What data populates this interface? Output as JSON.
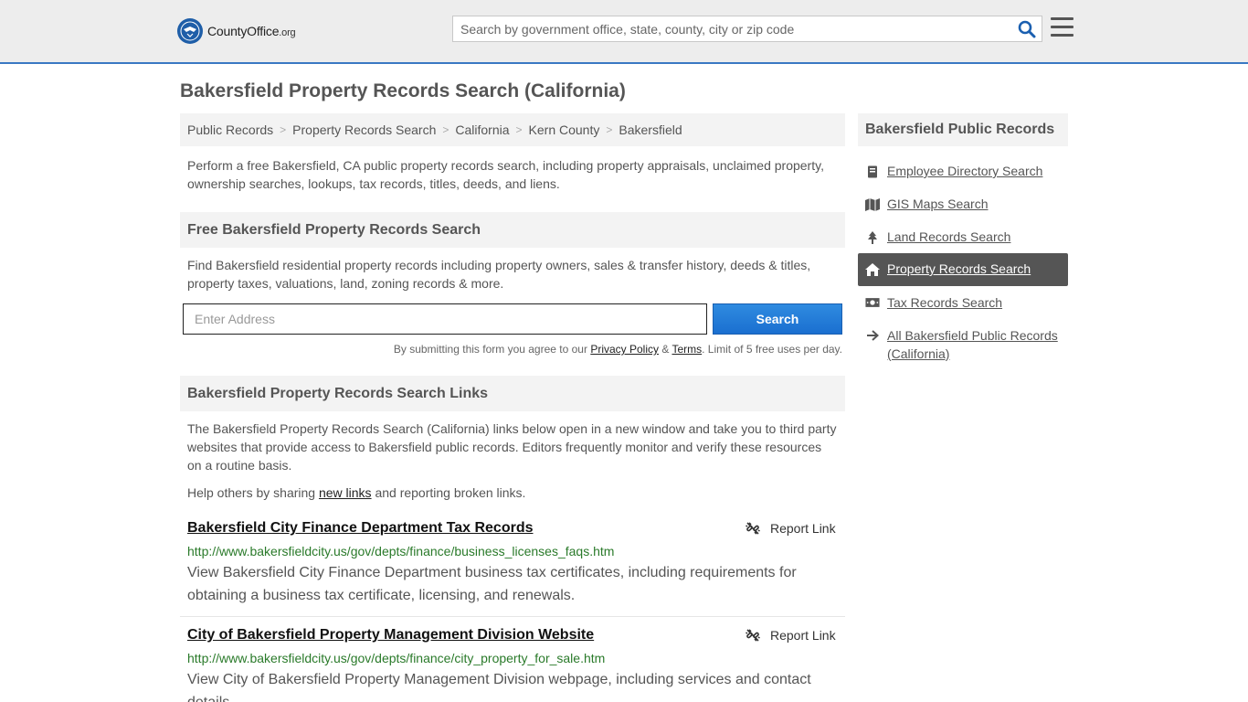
{
  "header": {
    "logo_main": "County",
    "logo_bold": "Office",
    "logo_tld": ".org",
    "search_placeholder": "Search by government office, state, county, city or zip code"
  },
  "page_title": "Bakersfield Property Records Search (California)",
  "breadcrumb": [
    "Public Records",
    "Property Records Search",
    "California",
    "Kern County",
    "Bakersfield"
  ],
  "intro": "Perform a free Bakersfield, CA public property records search, including property appraisals, unclaimed property, ownership searches, lookups, tax records, titles, deeds, and liens.",
  "search_section": {
    "heading": "Free Bakersfield Property Records Search",
    "description": "Find Bakersfield residential property records including property owners, sales & transfer history, deeds & titles, property taxes, valuations, land, zoning records & more.",
    "address_placeholder": "Enter Address",
    "button_label": "Search",
    "terms_prefix": "By submitting this form you agree to our ",
    "privacy_label": "Privacy Policy",
    "terms_amp": " & ",
    "terms_label": "Terms",
    "terms_suffix": ". Limit of 5 free uses per day."
  },
  "links_section": {
    "heading": "Bakersfield Property Records Search Links",
    "description": "The Bakersfield Property Records Search (California) links below open in a new window and take you to third party websites that provide access to Bakersfield public records. Editors frequently monitor and verify these resources on a routine basis.",
    "help_prefix": "Help others by sharing ",
    "help_link": "new links",
    "help_suffix": " and reporting broken links.",
    "report_label": "Report Link",
    "results": [
      {
        "title": "Bakersfield City Finance Department Tax Records",
        "url": "http://www.bakersfieldcity.us/gov/depts/finance/business_licenses_faqs.htm",
        "description": "View Bakersfield City Finance Department business tax certificates, including requirements for obtaining a business tax certificate, licensing, and renewals."
      },
      {
        "title": "City of Bakersfield Property Management Division Website",
        "url": "http://www.bakersfieldcity.us/gov/depts/finance/city_property_for_sale.htm",
        "description": "View City of Bakersfield Property Management Division webpage, including services and contact details."
      }
    ]
  },
  "sidebar": {
    "heading": "Bakersfield Public Records",
    "items": [
      {
        "label": "Employee Directory Search",
        "icon": "book-icon",
        "active": false
      },
      {
        "label": "GIS Maps Search",
        "icon": "map-icon",
        "active": false
      },
      {
        "label": "Land Records Search",
        "icon": "tree-icon",
        "active": false
      },
      {
        "label": "Property Records Search",
        "icon": "home-icon",
        "active": true
      },
      {
        "label": "Tax Records Search",
        "icon": "money-icon",
        "active": false
      },
      {
        "label": "All Bakersfield Public Records (California)",
        "icon": "arrow-right-icon",
        "active": false
      }
    ]
  },
  "colors": {
    "accent_blue": "#1a6fd0",
    "url_green": "#2a7a2a",
    "active_bg": "#555555"
  }
}
